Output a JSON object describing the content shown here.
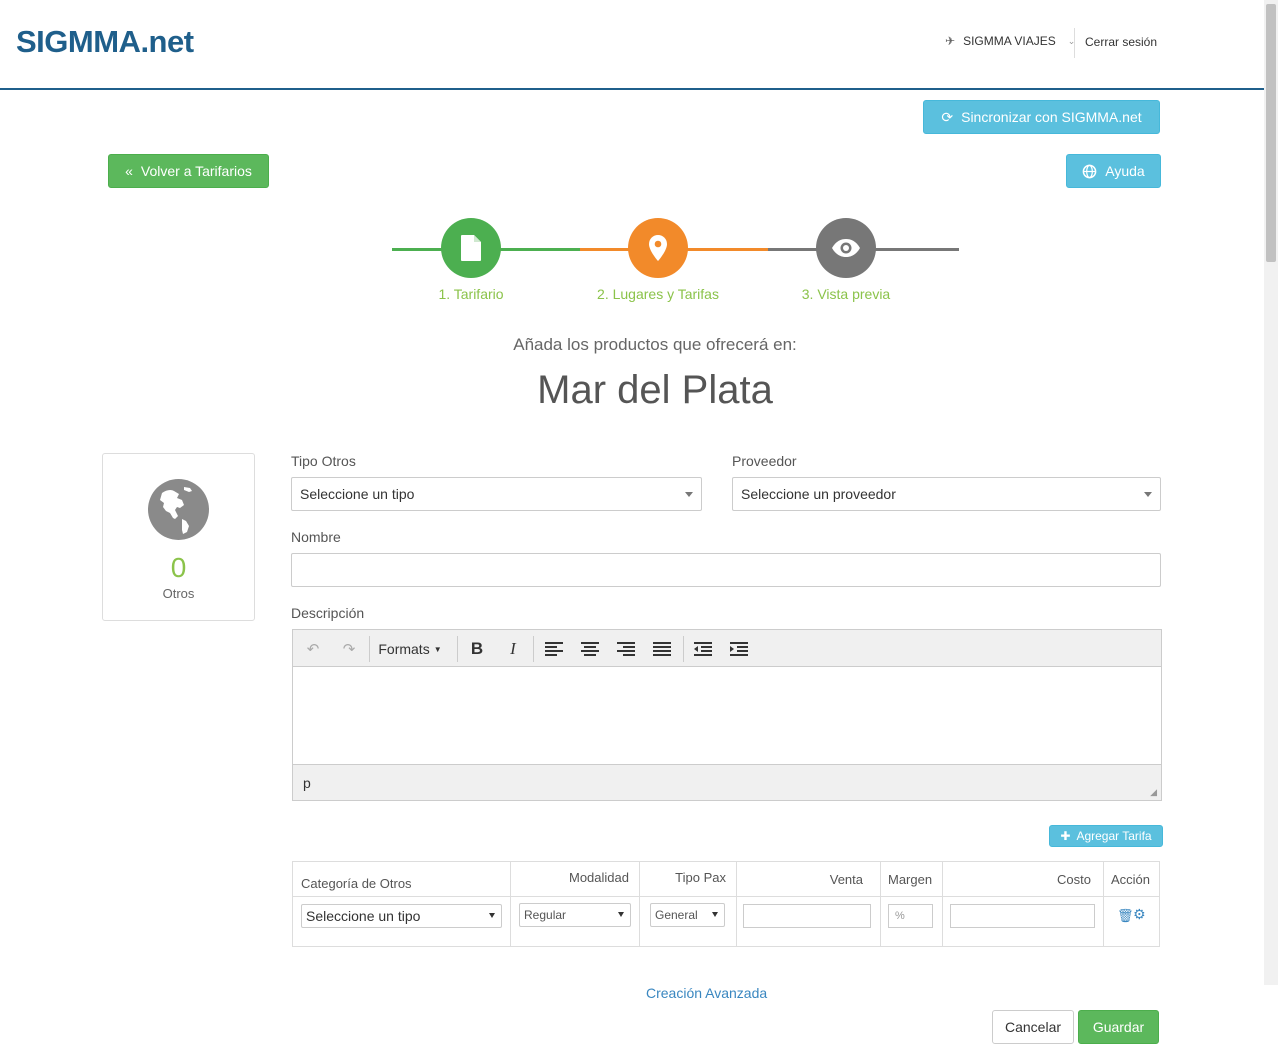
{
  "header": {
    "logo_main": "SIGMMA",
    "logo_suffix": ".net",
    "agency_name": "SIGMMA VIAJES",
    "logout_label": "Cerrar sesión"
  },
  "actions": {
    "sync_label": "Sincronizar con SIGMMA.net",
    "back_label": "Volver a Tarifarios",
    "help_label": "Ayuda"
  },
  "wizard": {
    "steps": [
      {
        "label": "1. Tarifario",
        "icon": "file-icon",
        "color": "#4caf50"
      },
      {
        "label": "2. Lugares y Tarifas",
        "icon": "map-marker-icon",
        "color": "#f28a2a"
      },
      {
        "label": "3. Vista previa",
        "icon": "eye-icon",
        "color": "#777777"
      }
    ]
  },
  "intro": {
    "subtitle": "Añada los productos que ofrecerá en:",
    "place": "Mar del Plata"
  },
  "counter": {
    "value": "0",
    "label": "Otros"
  },
  "form": {
    "tipo_label": "Tipo  Otros",
    "tipo_value": "Seleccione un tipo",
    "proveedor_label": "Proveedor",
    "proveedor_value": "Seleccione un proveedor",
    "nombre_label": "Nombre",
    "descripcion_label": "Descripción"
  },
  "editor": {
    "formats_label": "Formats",
    "status_path": "p"
  },
  "tarifas": {
    "add_label": "Agregar Tarifa",
    "columns": {
      "categoria": "Categoría de  Otros",
      "modalidad": "Modalidad",
      "tipo_pax": "Tipo  Pax",
      "venta": "Venta",
      "margen": "Margen",
      "costo": "Costo",
      "accion": "Acción"
    },
    "row": {
      "categoria": "Seleccione un tipo",
      "modalidad": "Regular",
      "tipo_pax": "General",
      "margen_placeholder": "%"
    }
  },
  "footer": {
    "advanced_link": "Creación Avanzada",
    "cancel_label": "Cancelar",
    "save_label": "Guardar"
  },
  "colors": {
    "brand": "#1f5f8b",
    "info": "#5bc0de",
    "success": "#5cb85c",
    "accent_green": "#8bc34a",
    "accent_orange": "#f28a2a"
  }
}
